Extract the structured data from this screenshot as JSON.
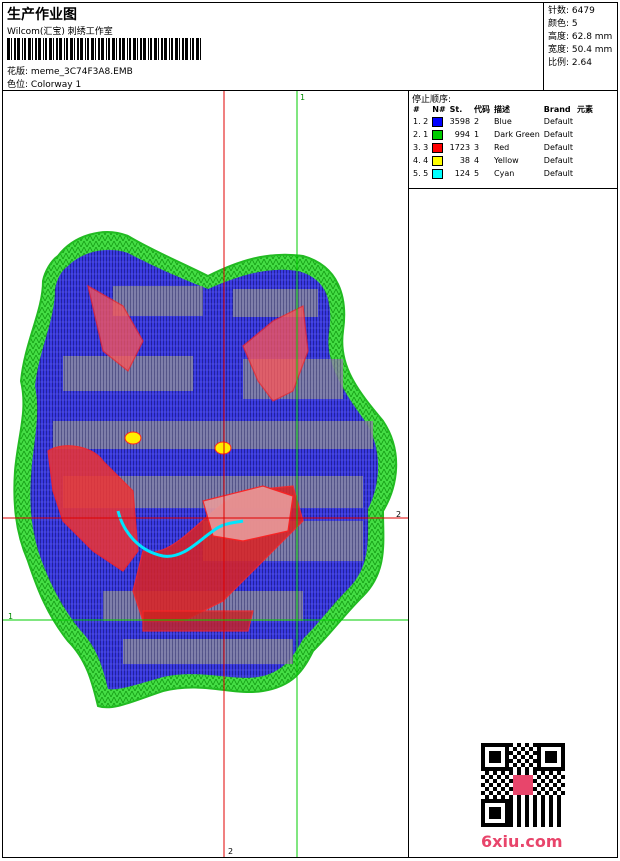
{
  "header": {
    "title": "生产作业图",
    "subtitle": "Wilcom(汇宝) 刺绣工作室",
    "design_label": "花版:",
    "design_value": "meme_3C74F3A8.EMB",
    "colorway_label": "色位:",
    "colorway_value": "Colorway 1"
  },
  "stats": {
    "stitches": "针数: 6479",
    "colors": "颜色: 5",
    "height": "高度: 62.8 mm",
    "width": "宽度: 50.4 mm",
    "scale": "比例: 2.64"
  },
  "stop_sequence": {
    "title": "停止顺序:",
    "columns": [
      "#",
      "N#",
      "St.",
      "代码",
      "描述",
      "Brand",
      "元素"
    ],
    "rows": [
      {
        "idx": "1. 2",
        "color": "#0000ff",
        "st": "3598",
        "code": "2",
        "desc": "Blue",
        "brand": "Default"
      },
      {
        "idx": "2. 1",
        "color": "#00cc00",
        "st": "994",
        "code": "1",
        "desc": "Dark Green",
        "brand": "Default"
      },
      {
        "idx": "3. 3",
        "color": "#ff0000",
        "st": "1723",
        "code": "3",
        "desc": "Red",
        "brand": "Default"
      },
      {
        "idx": "4. 4",
        "color": "#ffff00",
        "st": "38",
        "code": "4",
        "desc": "Yellow",
        "brand": "Default"
      },
      {
        "idx": "5. 5",
        "color": "#00ffff",
        "st": "124",
        "code": "5",
        "desc": "Cyan",
        "brand": "Default"
      }
    ]
  },
  "guides": {
    "v_green": "1",
    "h_red": "2",
    "h_green": "1",
    "v_red": "2"
  },
  "watermark": "6xiu.com"
}
